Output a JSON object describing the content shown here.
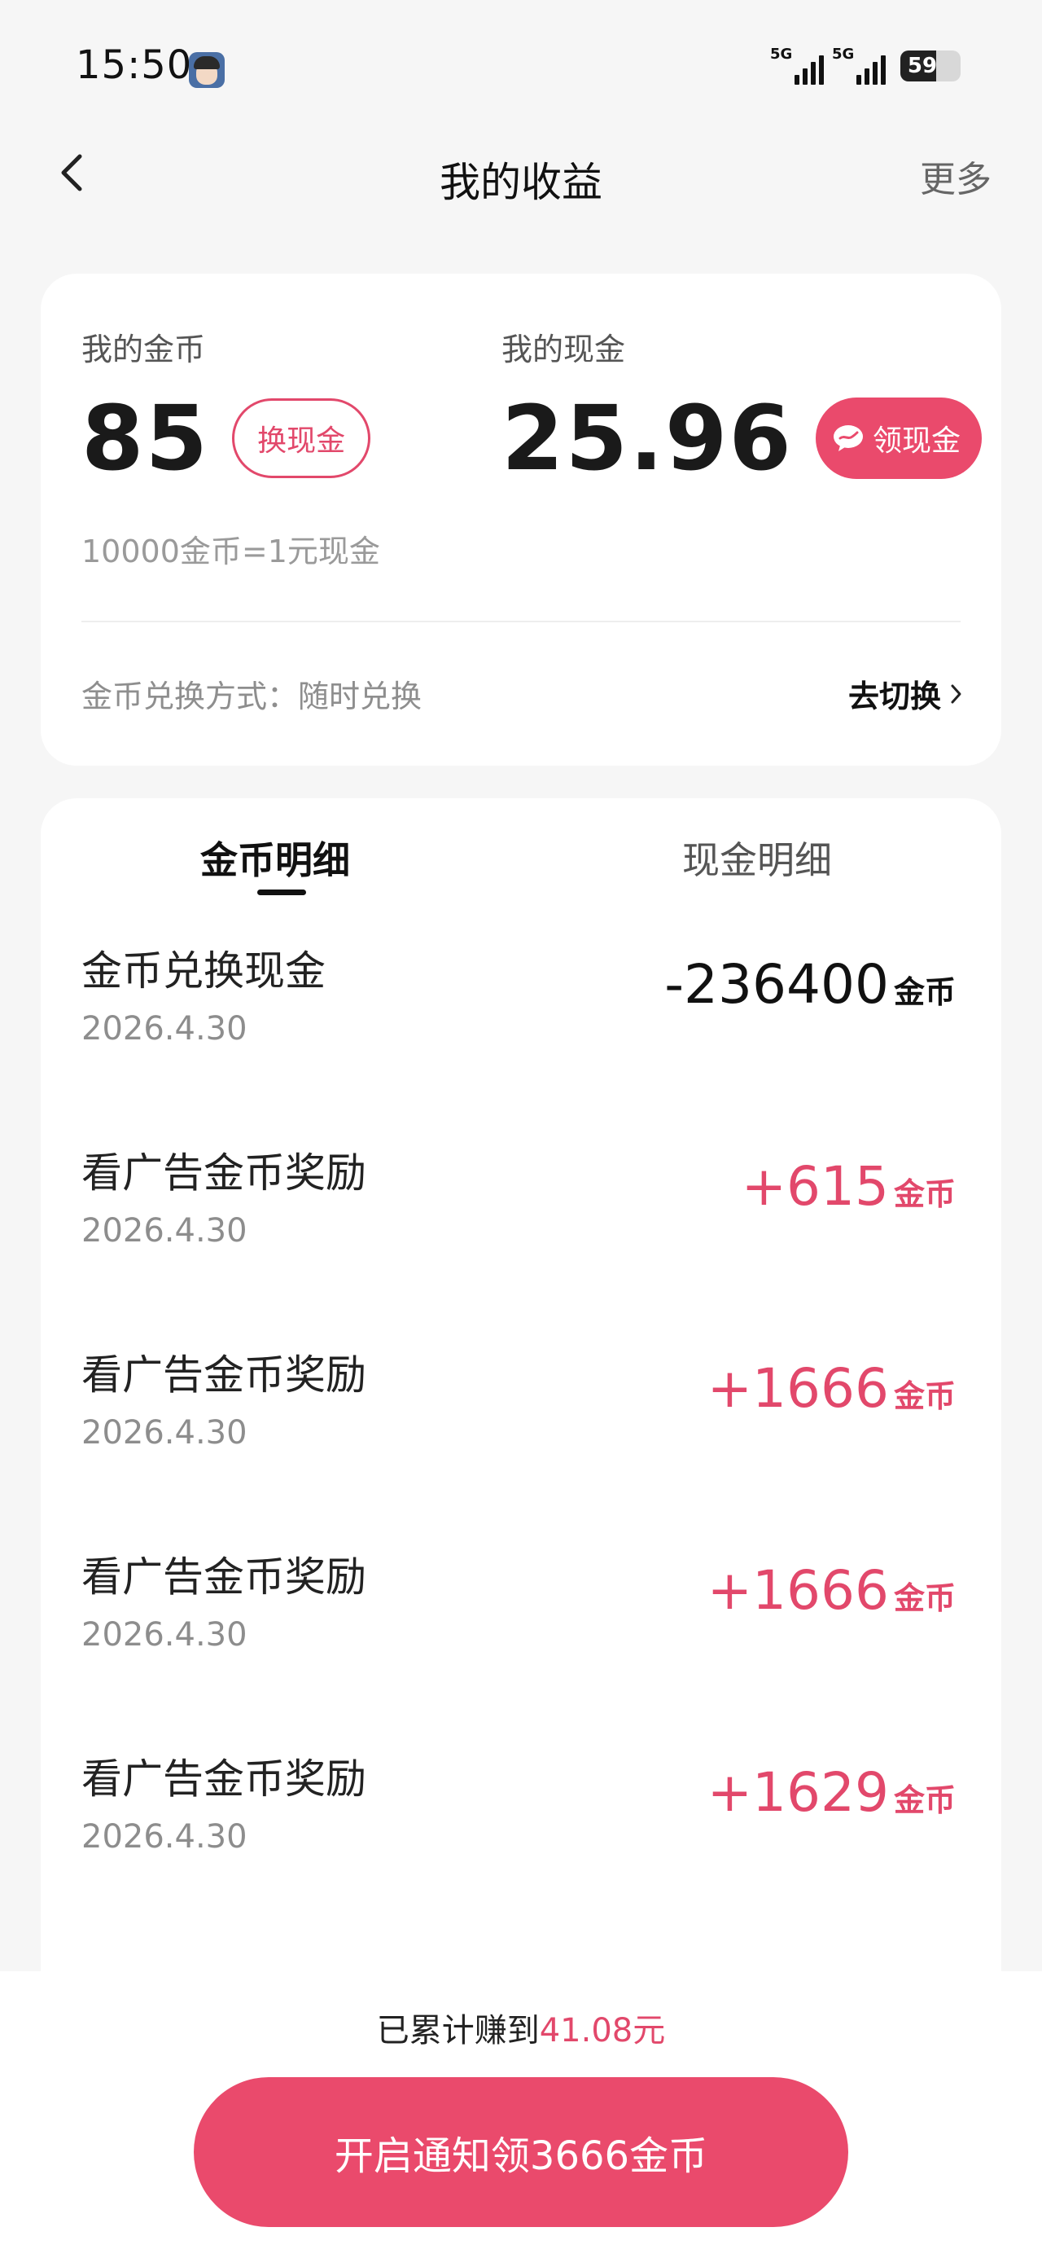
{
  "status_bar": {
    "time": "15:50",
    "signal_1_label": "5G",
    "signal_2_label": "5G",
    "battery_level": "59",
    "battery_fraction": 0.59
  },
  "nav": {
    "title": "我的收益",
    "more_label": "更多",
    "back_icon": "chevron-left-icon"
  },
  "balance": {
    "coins_label": "我的金币",
    "coins_value": "85",
    "exchange_button": "换现金",
    "cash_label": "我的现金",
    "cash_value": "25.96",
    "withdraw_button": "领现金",
    "withdraw_icon": "wechat-icon",
    "rate_text": "10000金币=1元现金",
    "exchange_mode_text": "金币兑换方式：随时兑换",
    "switch_label": "去切换",
    "switch_icon": "chevron-right-icon"
  },
  "tabs": [
    {
      "label": "金币明细",
      "active": true
    },
    {
      "label": "现金明细",
      "active": false
    }
  ],
  "records": [
    {
      "title": "金币兑换现金",
      "date": "2026.4.30",
      "amount": "-236400",
      "unit": "金币",
      "type": "negative"
    },
    {
      "title": "看广告金币奖励",
      "date": "2026.4.30",
      "amount": "+615",
      "unit": "金币",
      "type": "positive"
    },
    {
      "title": "看广告金币奖励",
      "date": "2026.4.30",
      "amount": "+1666",
      "unit": "金币",
      "type": "positive"
    },
    {
      "title": "看广告金币奖励",
      "date": "2026.4.30",
      "amount": "+1666",
      "unit": "金币",
      "type": "positive"
    },
    {
      "title": "看广告金币奖励",
      "date": "2026.4.30",
      "amount": "+1629",
      "unit": "金币",
      "type": "positive"
    }
  ],
  "bottom": {
    "earned_prefix": "已累计赚到",
    "earned_amount": "41.08元",
    "cta_label": "开启通知领3666金币"
  },
  "colors": {
    "accent": "#ea4a6c",
    "accent_text": "#e2486b",
    "background": "#f6f6f6"
  }
}
